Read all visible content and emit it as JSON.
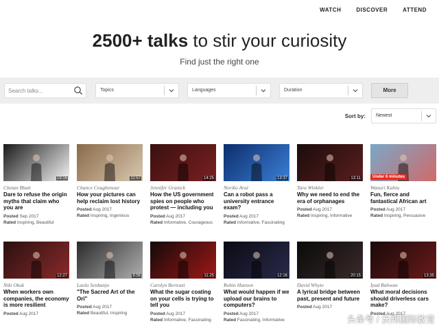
{
  "nav": {
    "watch": "WATCH",
    "discover": "DISCOVER",
    "attend": "ATTEND"
  },
  "hero": {
    "title_bold": "2500+ talks",
    "title_rest": " to stir your curiosity",
    "subtitle": "Find just the right one"
  },
  "filters": {
    "search_placeholder": "Search talks...",
    "topics": "Topics",
    "languages": "Languages",
    "duration": "Duration",
    "more": "More"
  },
  "sort": {
    "label": "Sort by:",
    "value": "Newest"
  },
  "talks": [
    {
      "speaker": "Chetan Bhatt",
      "title": "Dare to refuse the origin myths that claim who you are",
      "posted": "Sep 2017",
      "rated": "Inspiring, Beautiful",
      "duration": "19:16",
      "colors": [
        "#1a1a1a",
        "#f4f4f4"
      ]
    },
    {
      "speaker": "Chance Coughenour",
      "title": "How your pictures can help reclaim lost history",
      "posted": "Aug 2017",
      "rated": "Inspiring, Ingenious",
      "duration": "11:57",
      "colors": [
        "#8a6a48",
        "#d8c8b0"
      ]
    },
    {
      "speaker": "Jennifer Granick",
      "title": "How the US government spies on people who protest — including you",
      "posted": "Aug 2017",
      "rated": "Informative, Courageous",
      "duration": "14:25",
      "colors": [
        "#3a1010",
        "#7a2020"
      ]
    },
    {
      "speaker": "Noriko Arai",
      "title": "Can a robot pass a university entrance exam?",
      "posted": "Aug 2017",
      "rated": "Informative, Fascinating",
      "duration": "13:37",
      "colors": [
        "#0c2d6b",
        "#3b7fd6"
      ]
    },
    {
      "speaker": "Tara Winkler",
      "title": "Why we need to end the era of orphanages",
      "posted": "Aug 2017",
      "rated": "Inspiring, Informative",
      "duration": "13:11",
      "colors": [
        "#1b0c0c",
        "#5a1e1e"
      ]
    },
    {
      "speaker": "Wanuri Kahiu",
      "title": "Fun, fierce and fantastical African art",
      "posted": "Aug 2017",
      "rated": "Inspiring, Persuasive",
      "duration": "",
      "badge": "Under 6 minutes",
      "colors": [
        "#7aa8c8",
        "#d06a6a"
      ]
    },
    {
      "speaker": "Niki Okuk",
      "title": "When workers own companies, the economy is more resilient",
      "posted": "Aug 2017",
      "rated": "",
      "duration": "12:27",
      "colors": [
        "#2a1010",
        "#8b2a2a"
      ]
    },
    {
      "speaker": "Laolu Senbanjo",
      "title": "\"The Sacred Art of the Ori\"",
      "posted": "Aug 2017",
      "rated": "Beautiful, Inspiring",
      "duration": "8:56",
      "colors": [
        "#2a2a2a",
        "#b0b0b0"
      ]
    },
    {
      "speaker": "Carolyn Bertozzi",
      "title": "What the sugar coating on your cells is trying to tell you",
      "posted": "Aug 2017",
      "rated": "Informative, Fascinating",
      "duration": "11:25",
      "colors": [
        "#140a0a",
        "#a01818"
      ]
    },
    {
      "speaker": "Robin Hanson",
      "title": "What would happen if we upload our brains to computers?",
      "posted": "Aug 2017",
      "rated": "Fascinating, Informative",
      "duration": "12:16",
      "colors": [
        "#0a0a14",
        "#2a2a4a"
      ]
    },
    {
      "speaker": "David Whyte",
      "title": "A lyrical bridge between past, present and future",
      "posted": "Aug 2017",
      "rated": "",
      "duration": "20:15",
      "colors": [
        "#0a0a0a",
        "#3a2a2a"
      ]
    },
    {
      "speaker": "Iyad Rahwan",
      "title": "What moral decisions should driverless cars make?",
      "posted": "Aug 2017",
      "rated": "",
      "duration": "13:35",
      "colors": [
        "#1a0a0a",
        "#6a1a1a"
      ]
    }
  ],
  "labels": {
    "posted": "Posted",
    "rated": "Rated"
  },
  "watermark": "头条号 / 沃邦国际教育"
}
